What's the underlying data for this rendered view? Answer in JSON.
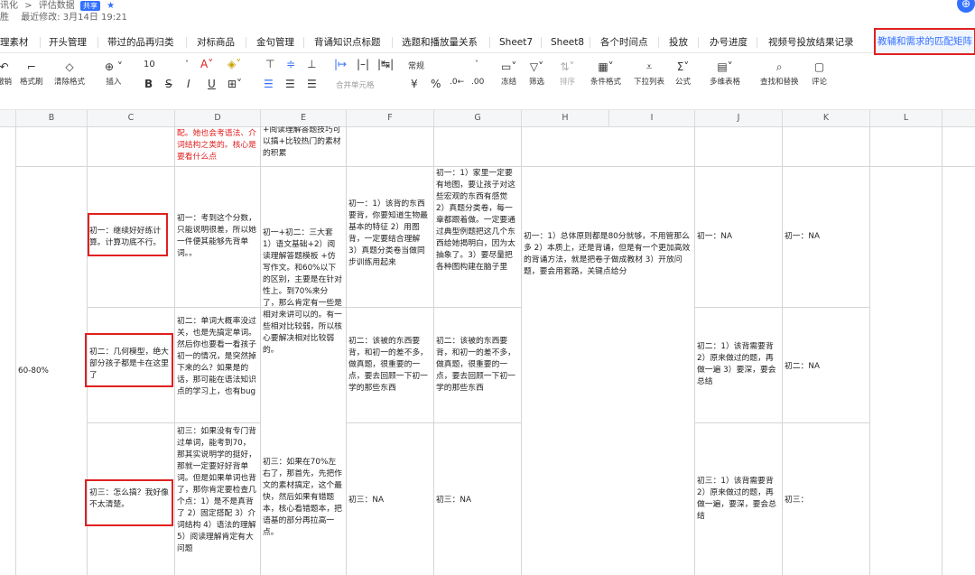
{
  "header": {
    "breadcrumb_prefix": "讯化",
    "breadcrumb_sep": ">",
    "doc_title": "评估数据",
    "share_tag": "共享",
    "owner": "胜",
    "last_modified": "最近修改: 3月14日 19:21"
  },
  "sheet_tabs": [
    "理素材",
    "开头管理",
    "带过的品再归类",
    "对标商品",
    "金句管理",
    "背诵知识点标题",
    "选题和播放量关系",
    "Sheet7",
    "Sheet8",
    "各个时间点",
    "投放",
    "办号进度",
    "视频号投放结果记录",
    "教辅和需求的匹配矩阵"
  ],
  "toolbar": {
    "font_size": "10",
    "number_format": "常规",
    "labels": {
      "undo": "撤销",
      "format_painter": "格式刷",
      "clear_format": "清除格式",
      "insert": "插入",
      "merge": "合并单元格",
      "freeze": "冻结",
      "filter": "筛选",
      "sort": "排序",
      "cond_format": "条件格式",
      "dropdown": "下拉列表",
      "formula": "公式",
      "multi_table": "多维表格",
      "find_replace": "查找和替换",
      "comment": "评论"
    }
  },
  "columns": [
    "B",
    "C",
    "D",
    "E",
    "F",
    "G",
    "H",
    "I",
    "J",
    "K",
    "L"
  ],
  "cells": {
    "D1": "配。她也会考语法、介词结构之类的。核心是要看什么点",
    "E1": "+阅读理解答题技巧可以搞+比较热门的素材的积累",
    "C2": "初一：继续好好练计算。计算功底不行。",
    "D2": "初一：考到这个分数，只能说明很差，所以她一件便其能够先背单词。。",
    "E2": "初一+初二：三大套 1）语文基础+2）阅读理解答题模板 +仿写作文。和60%以下的区别，主要是在针对性上。到70%来分了，那么肯定有一些是相对来讲可以的。有一些相对比较弱，所以核心要解决相对比较弱的。",
    "F2": "初一：1）该背的东西要背，你要知道生物最基本的特征 2）用图背，一定要结合理解 3）真题分类卷当做同步训练用起来",
    "G2": "初一：1）家里一定要有地图，要让孩子对这些宏观的东西有感觉 2）真题分类卷，每一章都跟着做。一定要通过典型例题把这几个东西给她揭明白，因为太抽象了。3）要尽量把各种图构建在脑子里",
    "H2": "初一：1）总体原则都是80分就够，不用管那么多 2）本质上，还是背诵，但是有一个更加高效的背诵方法，就是把卷子做成教材 3）开放问题，要会用套路，关键点给分",
    "J2": "初一：NA",
    "K2": "初一：NA",
    "B3": "60-80%",
    "C3": "初二：几何模型，绝大部分孩子都是卡在这里了",
    "D3": "初二：单词大概率没过关，也是先搞定单词。然后你也要看一看孩子初一的情况，是突然掉下来的么？如果是的话，那可能在语法知识点的学习上，也有bug",
    "F3": "初二：该被的东西要背，和初一的差不多，做真题，很重要的一点，要去回顾一下初一学的那些东西",
    "G3": "初二：该被的东西要背，和初一的差不多，做真题，很重要的一点，要去回顾一下初一学的那些东西",
    "J3": "初二：1）该背需要背 2）原来做过的题，再做一遍 3）要深，要会总结",
    "K3": "初二：NA",
    "C4": "初三：怎么搞？我好像不太清楚。",
    "D4": "初三：如果没有专门背过单词，能考到70，那其实说明学的挺好，那就一定要好好背单词。但是如果单词也背了，那你肯定要检查几个点：1）是不是真背了 2）固定搭配 3）介词结构 4）语法的理解 5）阅读理解肯定有大问题",
    "E4": "初三：如果在70%左右了，那首先，先把作文的素材搞定，这个最快，然后如果有错题本，核心看错题本，把语基的部分再拉高一点。",
    "F4": "初三：NA",
    "G4": "初三：NA",
    "J4": "初三：1）该背需要背 2）原来做过的题，再做一遍，要深，要会总结",
    "K4": "初三："
  },
  "colors": {
    "accent": "#3370ff",
    "highlight_red": "#e02020"
  }
}
